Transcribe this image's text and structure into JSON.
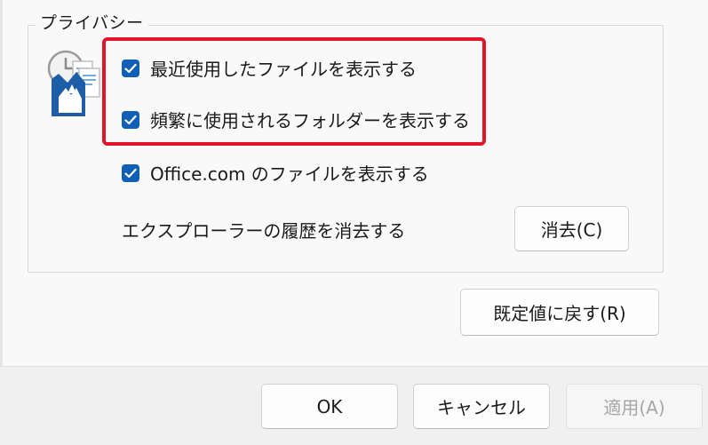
{
  "privacy": {
    "legend": "プライバシー",
    "icon": "privacy-documents-icon",
    "checkboxes": [
      {
        "label": "最近使用したファイルを表示する",
        "checked": true
      },
      {
        "label": "頻繁に使用されるフォルダーを表示する",
        "checked": true
      },
      {
        "label": "Office.com のファイルを表示する",
        "checked": true
      }
    ],
    "clear_history_label": "エクスプローラーの履歴を消去する",
    "clear_button": "消去(C)"
  },
  "restore_defaults_button": "既定値に戻す(R)",
  "dialog_buttons": {
    "ok": "OK",
    "cancel": "キャンセル",
    "apply": "適用(A)",
    "apply_enabled": false
  },
  "colors": {
    "checkbox_accent": "#0f5fb8",
    "highlight_border": "#e2142a"
  }
}
